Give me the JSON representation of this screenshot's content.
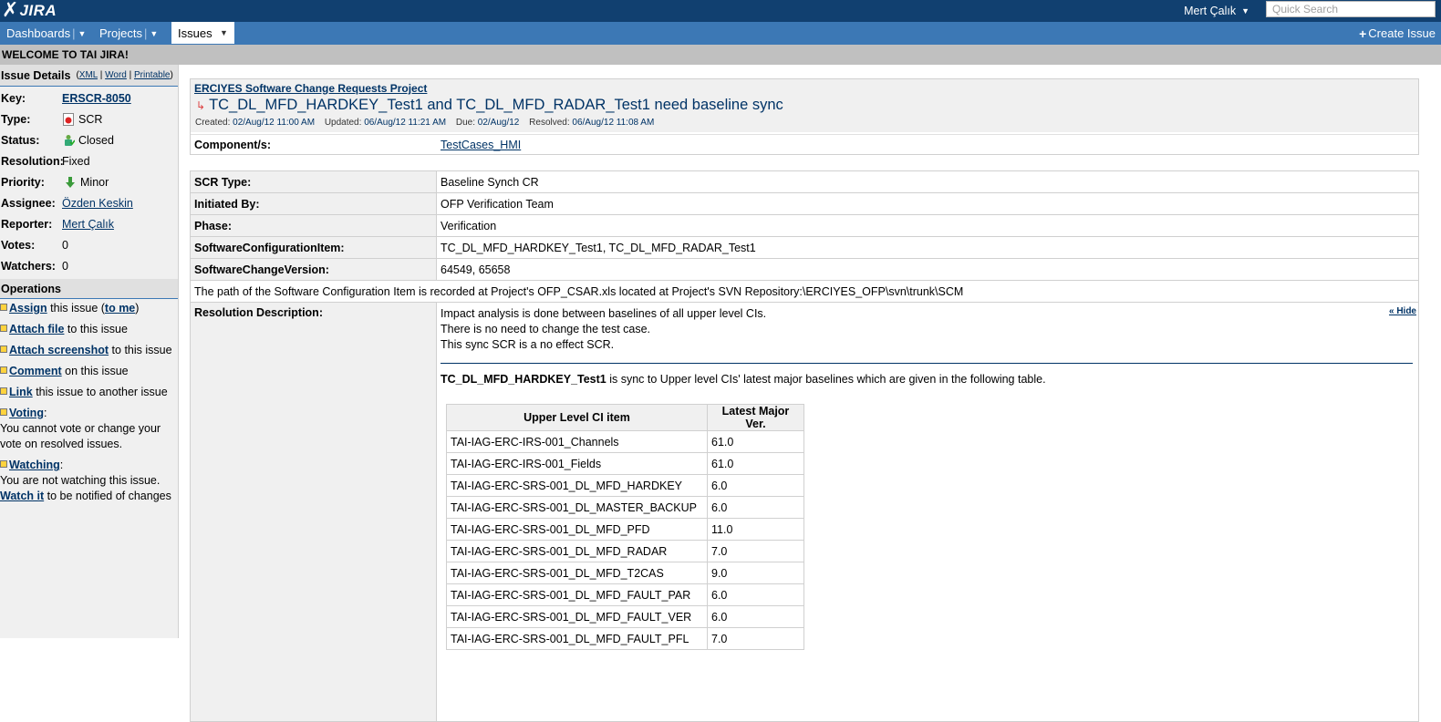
{
  "header": {
    "logo_text": "JIRA",
    "user_name": "Mert Çalık",
    "search_placeholder": "Quick Search"
  },
  "nav": {
    "dashboards": "Dashboards",
    "projects": "Projects",
    "issues": "Issues",
    "create_issue": "Create Issue"
  },
  "welcome": "WELCOME TO TAI JIRA!",
  "issue_details": {
    "heading": "Issue Details",
    "links": {
      "xml": "XML",
      "word": "Word",
      "printable": "Printable"
    },
    "rows": {
      "key": {
        "label": "Key:",
        "value": "ERSCR-8050"
      },
      "type": {
        "label": "Type:",
        "value": "SCR"
      },
      "status": {
        "label": "Status:",
        "value": "Closed"
      },
      "resolution": {
        "label": "Resolution:",
        "value": "Fixed"
      },
      "priority": {
        "label": "Priority:",
        "value": "Minor"
      },
      "assignee": {
        "label": "Assignee:",
        "value": "Özden Keskin"
      },
      "reporter": {
        "label": "Reporter:",
        "value": "Mert Çalık"
      },
      "votes": {
        "label": "Votes:",
        "value": "0"
      },
      "watchers": {
        "label": "Watchers:",
        "value": "0"
      }
    }
  },
  "operations": {
    "heading": "Operations",
    "assign": {
      "link": "Assign",
      "text": "this issue",
      "link2": "to me"
    },
    "attach_file": {
      "link": "Attach file",
      "text": "to this issue"
    },
    "attach_screenshot": {
      "link": "Attach screenshot",
      "text": "to this issue"
    },
    "comment": {
      "link": "Comment",
      "text": "on this issue"
    },
    "link": {
      "link": "Link",
      "text": "this issue to another issue"
    },
    "voting": {
      "link": "Voting",
      "note": "You cannot vote or change your vote on resolved issues."
    },
    "watching": {
      "link": "Watching",
      "note": "You are not watching this issue.",
      "watch_link": "Watch it",
      "watch_text": "to be notified of changes"
    }
  },
  "issue": {
    "project": "ERCIYES Software Change Requests Project",
    "title": "TC_DL_MFD_HARDKEY_Test1 and TC_DL_MFD_RADAR_Test1 need baseline sync",
    "created_label": "Created:",
    "created": "02/Aug/12 11:00 AM",
    "updated_label": "Updated:",
    "updated": "06/Aug/12 11:21 AM",
    "due_label": "Due:",
    "due": "02/Aug/12",
    "resolved_label": "Resolved:",
    "resolved": "06/Aug/12 11:08 AM",
    "component_label": "Component/s:",
    "component": "TestCases_HMI"
  },
  "fields": {
    "scr_type": {
      "label": "SCR Type:",
      "value": "Baseline Synch CR"
    },
    "initiated_by": {
      "label": "Initiated By:",
      "value": "OFP Verification Team"
    },
    "phase": {
      "label": "Phase:",
      "value": "Verification"
    },
    "sci": {
      "label": "SoftwareConfigurationItem:",
      "value": "TC_DL_MFD_HARDKEY_Test1, TC_DL_MFD_RADAR_Test1"
    },
    "scv": {
      "label": "SoftwareChangeVersion:",
      "value": "64549, 65658"
    },
    "path_note": "The path of the Software Configuration Item is recorded at Project's OFP_CSAR.xls located at Project's SVN Repository:\\ERCIYES_OFP\\svn\\trunk\\SCM",
    "resolution": {
      "label": "Resolution Description:",
      "hide": "« Hide",
      "line1": "Impact analysis is done between baselines of all upper level CIs.",
      "line2": "There is no need to change the test case.",
      "line3": "This sync SCR is a no effect SCR.",
      "sync_bold": "TC_DL_MFD_HARDKEY_Test1",
      "sync_text": "is sync to Upper level CIs' latest major baselines which are given in the following table."
    }
  },
  "upper_table": {
    "headers": [
      "Upper Level CI item",
      "Latest Major Ver."
    ],
    "rows": [
      [
        "TAI-IAG-ERC-IRS-001_Channels",
        "61.0"
      ],
      [
        "TAI-IAG-ERC-IRS-001_Fields",
        "61.0"
      ],
      [
        "TAI-IAG-ERC-SRS-001_DL_MFD_HARDKEY",
        "6.0"
      ],
      [
        "TAI-IAG-ERC-SRS-001_DL_MASTER_BACKUP",
        "6.0"
      ],
      [
        "TAI-IAG-ERC-SRS-001_DL_MFD_PFD",
        "11.0"
      ],
      [
        "TAI-IAG-ERC-SRS-001_DL_MFD_RADAR",
        "7.0"
      ],
      [
        "TAI-IAG-ERC-SRS-001_DL_MFD_T2CAS",
        "9.0"
      ],
      [
        "TAI-IAG-ERC-SRS-001_DL_MFD_FAULT_PAR",
        "6.0"
      ],
      [
        "TAI-IAG-ERC-SRS-001_DL_MFD_FAULT_VER",
        "6.0"
      ],
      [
        "TAI-IAG-ERC-SRS-001_DL_MFD_FAULT_PFL",
        "7.0"
      ]
    ]
  },
  "icons": {
    "type": "scr-icon",
    "status": "closed-icon",
    "priority": "minor-priority-arrow-icon",
    "subtask": "subtask-arrow-icon"
  },
  "colors": {
    "topbar": "#114070",
    "navbar": "#3c78b5",
    "link": "#003366"
  }
}
